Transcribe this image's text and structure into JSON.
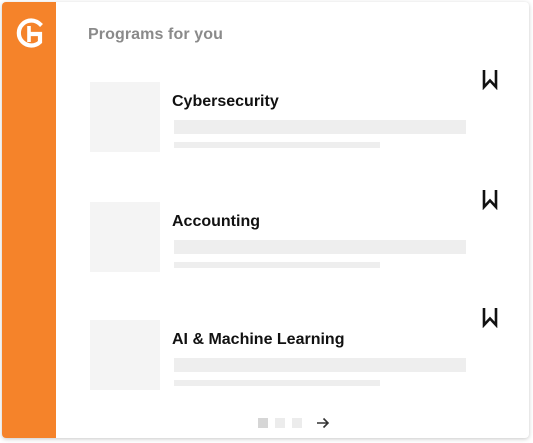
{
  "colors": {
    "accent": "#f5832a",
    "logo_mark": "#ffffff",
    "header_text": "#8a8a8a",
    "title_text": "#111111",
    "placeholder": "#eeeeee"
  },
  "sidebar": {
    "logo_icon": "stylized-g-logo"
  },
  "header": {
    "title": "Programs for you"
  },
  "programs": [
    {
      "title": "Cybersecurity",
      "bookmark_icon": "bookmark-icon"
    },
    {
      "title": "Accounting",
      "bookmark_icon": "bookmark-icon"
    },
    {
      "title": "AI & Machine Learning",
      "bookmark_icon": "bookmark-icon"
    }
  ],
  "pagination": {
    "pages": 3,
    "current_page": 1,
    "next_icon": "arrow-right-icon"
  }
}
